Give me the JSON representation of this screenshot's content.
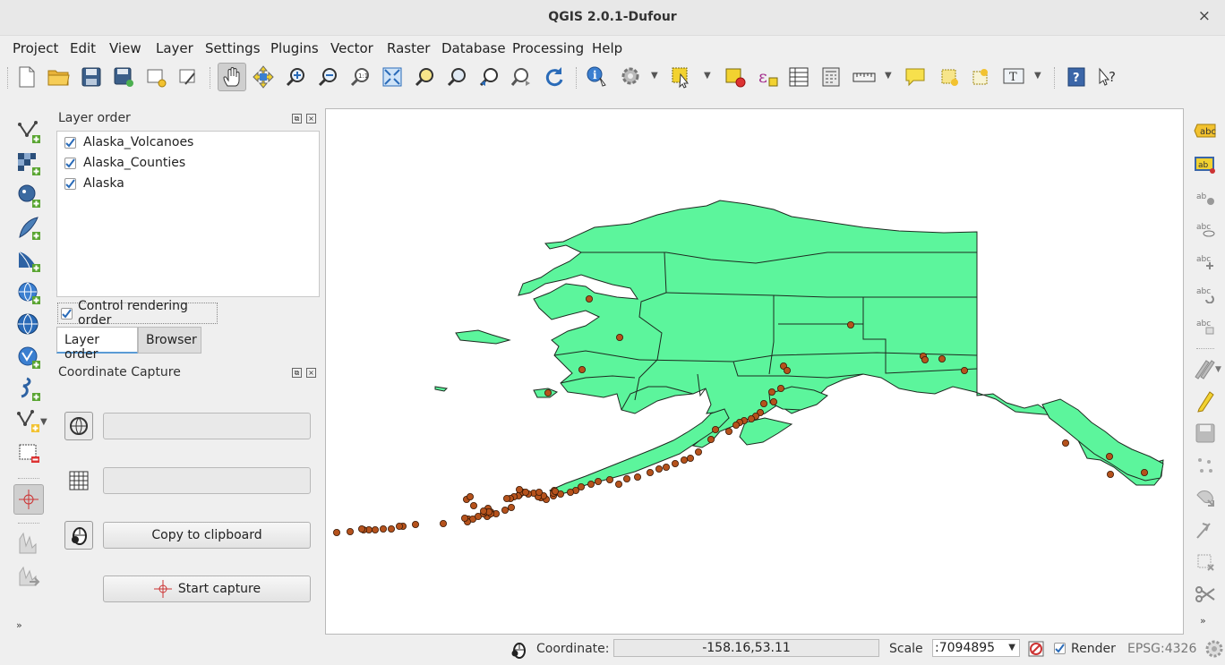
{
  "window": {
    "title": "QGIS 2.0.1-Dufour",
    "close_glyph": "×"
  },
  "menu": [
    "Project",
    "Edit",
    "View",
    "Layer",
    "Settings",
    "Plugins",
    "Vector",
    "Raster",
    "Database",
    "Processing",
    "Help"
  ],
  "layer_panel": {
    "title": "Layer order",
    "layers": [
      "Alaska_Volcanoes",
      "Alaska_Counties",
      "Alaska"
    ],
    "control_rendering_order": "Control rendering order",
    "tabs": [
      "Layer order",
      "Browser"
    ]
  },
  "coordinate_capture": {
    "title": "Coordinate Capture",
    "copy_button": "Copy to clipboard",
    "start_button": "Start capture"
  },
  "statusbar": {
    "coordinate_label": "Coordinate:",
    "coordinate_value": "-158.16,53.11",
    "scale_label": "Scale",
    "scale_value": ":7094895",
    "render_label": "Render",
    "crs": "EPSG:4326"
  },
  "map": {
    "land_color": "#5cf59c",
    "volcano_color": "#b5521c",
    "outline_color": "#1d2a20"
  },
  "right_toolbar": {
    "label_icon_text": "abc"
  }
}
